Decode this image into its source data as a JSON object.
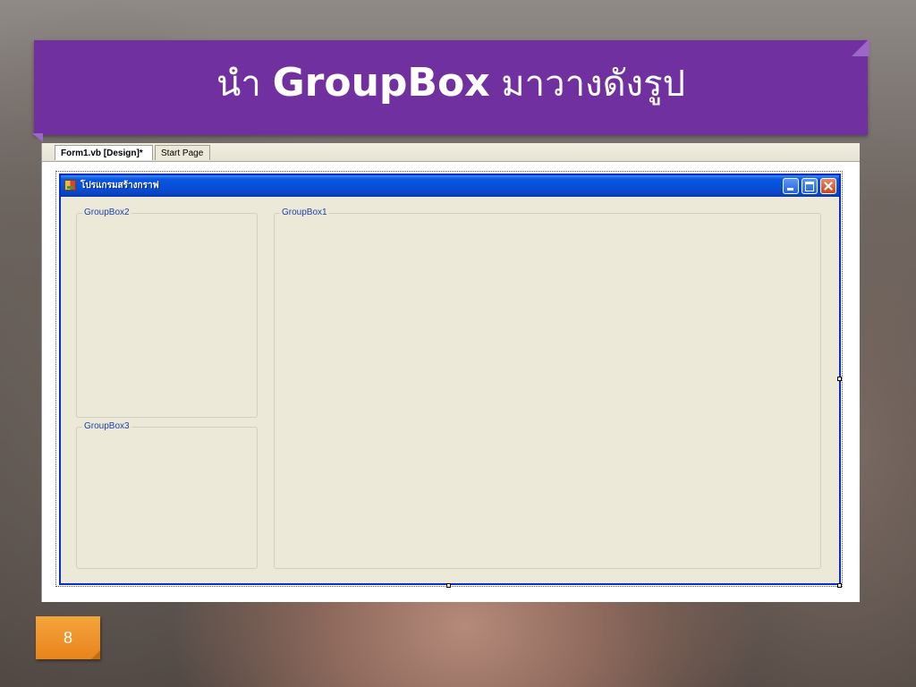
{
  "slide": {
    "title_prefix": "นำ ",
    "title_keyword": "GroupBox",
    "title_suffix": " มาวางดังรูป",
    "number": "8"
  },
  "colors": {
    "banner": "#7030a0",
    "slide_number_badge": "#e8841a",
    "titlebar": "#0550d8",
    "form_background": "#ece9d8",
    "groupbox_label": "#1b3fa6"
  },
  "ide": {
    "tabs": [
      {
        "label": "Form1.vb [Design]*",
        "active": true
      },
      {
        "label": "Start Page",
        "active": false
      }
    ]
  },
  "form": {
    "title": "โปรแกรมสร้างกราฟ",
    "icon": "form-icon",
    "caption_buttons": [
      "minimize-icon",
      "maximize-icon",
      "close-icon"
    ],
    "groupboxes": [
      {
        "label": "GroupBox2"
      },
      {
        "label": "GroupBox1"
      },
      {
        "label": "GroupBox3"
      }
    ]
  }
}
